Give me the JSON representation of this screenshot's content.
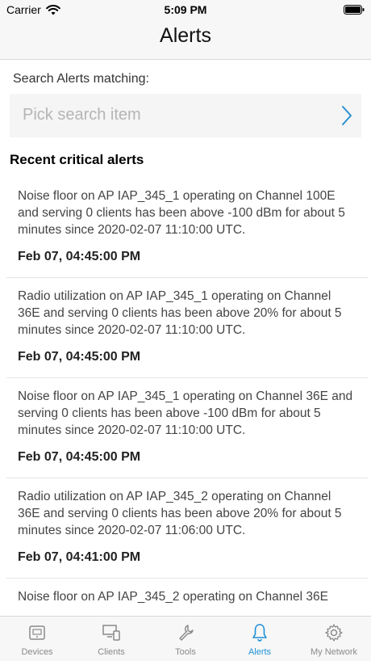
{
  "status_bar": {
    "carrier": "Carrier",
    "time": "5:09 PM"
  },
  "header": {
    "title": "Alerts"
  },
  "search": {
    "label": "Search Alerts matching:",
    "placeholder": "Pick search item"
  },
  "section": {
    "heading": "Recent critical alerts"
  },
  "alerts": [
    {
      "text": "Noise floor on AP IAP_345_1 operating on Channel 100E and serving 0 clients has been above -100 dBm for about 5 minutes since 2020-02-07 11:10:00 UTC.",
      "time": "Feb 07, 04:45:00 PM"
    },
    {
      "text": "Radio utilization on AP IAP_345_1 operating on Channel 36E and serving 0 clients has been above 20% for about 5 minutes since 2020-02-07 11:10:00 UTC.",
      "time": "Feb 07, 04:45:00 PM"
    },
    {
      "text": "Noise floor on AP IAP_345_1 operating on Channel 36E and serving 0 clients has been above -100 dBm for about 5 minutes since 2020-02-07 11:10:00 UTC.",
      "time": "Feb 07, 04:45:00 PM"
    },
    {
      "text": "Radio utilization on AP IAP_345_2 operating on Channel 36E and serving 0 clients has been above 20% for about 5 minutes since 2020-02-07 11:06:00 UTC.",
      "time": "Feb 07, 04:41:00 PM"
    },
    {
      "text": "Noise floor on AP IAP_345_2 operating on Channel 36E",
      "time": ""
    }
  ],
  "tabs": [
    {
      "label": "Devices",
      "icon": "devices-icon",
      "active": false
    },
    {
      "label": "Clients",
      "icon": "clients-icon",
      "active": false
    },
    {
      "label": "Tools",
      "icon": "tools-icon",
      "active": false
    },
    {
      "label": "Alerts",
      "icon": "bell-icon",
      "active": true
    },
    {
      "label": "My Network",
      "icon": "gear-icon",
      "active": false
    }
  ],
  "colors": {
    "accent": "#1e90d6",
    "inactive_tab": "#8a8a8a"
  }
}
